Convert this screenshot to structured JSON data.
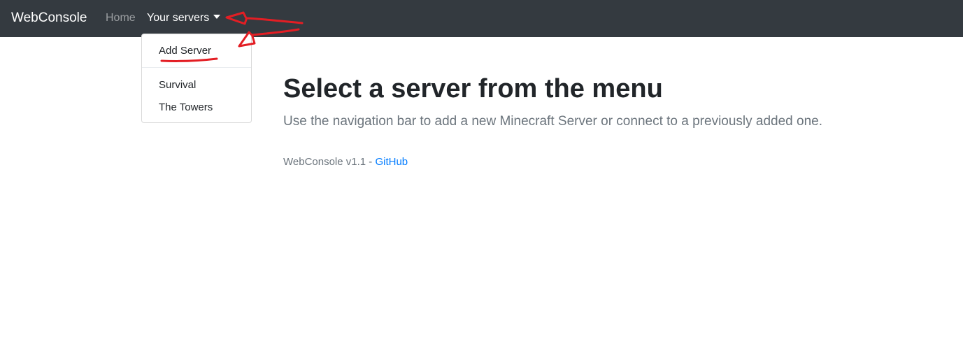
{
  "navbar": {
    "brand": "WebConsole",
    "home": "Home",
    "servers": "Your servers"
  },
  "dropdown": {
    "add_server": "Add Server",
    "servers": [
      "Survival",
      "The Towers"
    ]
  },
  "main": {
    "title": "Select a server from the menu",
    "lead": "Use the navigation bar to add a new Minecraft Server or connect to a previously added one."
  },
  "footer": {
    "version": "WebConsole v1.1",
    "separator": " - ",
    "link": "GitHub"
  },
  "colors": {
    "navbar": "#343a40",
    "link": "#007bff",
    "annotation": "#e31e24"
  }
}
